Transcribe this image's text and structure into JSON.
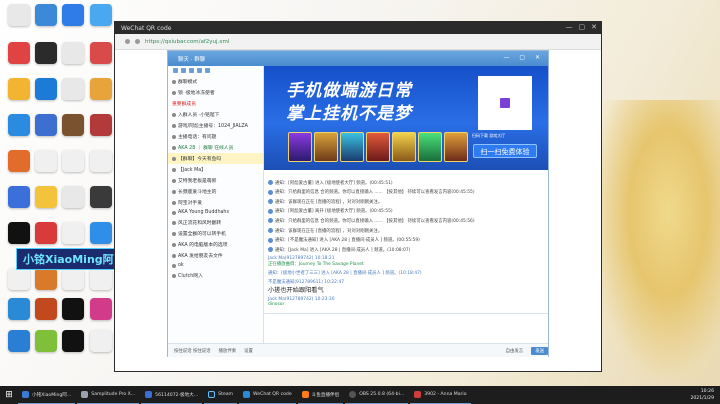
{
  "desktop": {
    "streamer_label": "小铭XiaoMing阿"
  },
  "window": {
    "title": "WeChat QR code",
    "url": "https://qxiubar.com/af2yuj.xml",
    "controls": [
      "—",
      "▢",
      "✕"
    ]
  },
  "qq_group": {
    "top_title": "聊天 · 群聊",
    "left_panel": {
      "rows": [
        {
          "text": "群聊模式",
          "style": "normal"
        },
        {
          "text": "锁 ·极地冰冻使者",
          "style": "normal"
        },
        {
          "text": "重要群成员",
          "style": "red"
        },
        {
          "text": "入群人员 ·小铭陛下",
          "style": "normal"
        },
        {
          "text": "游戏/阿彪主播号：1024_JIALZA",
          "style": "normal"
        },
        {
          "text": "主播电话：有问题",
          "style": "normal"
        },
        {
          "text": "AKA 28 ｜ 群聊 在线人员",
          "style": "green"
        },
        {
          "text": "【群聊】今天有鱼吗",
          "style": "hl"
        },
        {
          "text": "【Jack Ma】",
          "style": "normal"
        },
        {
          "text": "艾特我老板是萌新",
          "style": "normal"
        },
        {
          "text": "长颈鹿爱斗地主的",
          "style": "normal"
        },
        {
          "text": "阿宝对手爱",
          "style": "normal"
        },
        {
          "text": "AKA Young Buddhahs",
          "style": "normal"
        },
        {
          "text": "风正流花和风时翻转",
          "style": "normal"
        },
        {
          "text": "设置全群的可以转手机",
          "style": "normal"
        },
        {
          "text": "AKA 的电脑版本的选项",
          "style": "normal"
        },
        {
          "text": "AKA 发给朋友去文件",
          "style": "normal"
        },
        {
          "text": "ok",
          "style": "normal"
        },
        {
          "text": "Clutch网入",
          "style": "normal"
        }
      ]
    },
    "banner": {
      "line1": "手机做端游日常",
      "line2": "掌上挂机不是梦",
      "qr_caption": "扫码下载 游戏大厅",
      "scan_button": "扫一扫免费体验"
    },
    "messages": [
      {
        "kind": "sys",
        "text": "通知：[阿彪爱古董] 进入 [极地使者大厅]  频道。(00:45:51)"
      },
      {
        "kind": "sys",
        "text": "通知：只给群里的信息 合的频道。你可以直接输入 ......  【按其他】 持续可以查看发言内容(00:45:55)"
      },
      {
        "kind": "sys",
        "text": "通知：该群现在正在 [直播的流程] ，对对对刚刚关注。"
      },
      {
        "kind": "sys",
        "text": "通知：[阿彪爱古董] 离开 [极地使者大厅] 频道。(00:45:55)"
      },
      {
        "kind": "sys",
        "text": "通知：只给群里的信息 合的频道。你可以直接输入 ......  【按其他】 持续可以查看发言内容(00:45:56)"
      },
      {
        "kind": "sys",
        "text": "通知：该群现在正在 [直播的流程] ，对对对刚刚关注。"
      },
      {
        "kind": "sys",
        "text": "通知：[不是魔法通知] 进入 [AKA 28 | 直播间·成员人 ] 频道。(00:55:59)"
      },
      {
        "kind": "sys",
        "text": "通知：[Jack Ma] 进入 [AKA 28 | 直播间·成员人 ] 频道。(10:08:07)"
      },
      {
        "kind": "user",
        "name": "Jack Ma(912789742) 10:18:21",
        "line2": "正在播放曲目：Journey To The Savage Planet",
        "big": ""
      },
      {
        "kind": "user",
        "name": "通知：[极地小世者了三三] 进入 [AKA 28 | 直播间·成员人 ] 频道。(10:18:47)",
        "line2": "",
        "big": ""
      },
      {
        "kind": "user",
        "name": "不是魔法通知(912789611) 10:22:47",
        "line2": "",
        "big": "小搓也开始跟阳看气"
      },
      {
        "kind": "user",
        "name": "Jack Ma(912789742) 10:23:30",
        "line2": "dinosor",
        "big": ""
      }
    ],
    "bottom_bar": {
      "mic": "按住说话 按住说话",
      "record": "播放伴奏",
      "settings": "设置",
      "mode": "自由发言",
      "send": "发送"
    }
  },
  "taskbar": {
    "items": [
      {
        "label": "小铭XiaoMing阿...",
        "color": "#3a7bd5"
      },
      {
        "label": "Samplitude Pro X...",
        "color": "#9aa2ad"
      },
      {
        "label": "56114072·极地大...",
        "color": "#3a6fd8"
      },
      {
        "label": "Steam",
        "color": "#1b2838"
      },
      {
        "label": "WeChat QR code",
        "color": "#2b8ad6"
      },
      {
        "label": "斗鱼直播伴侣",
        "color": "#ff7a1a"
      },
      {
        "label": "OBS 25.0.8 (64-bi...",
        "color": "#555555"
      },
      {
        "label": "3902 - Anna Mario",
        "color": "#d23b3b"
      }
    ],
    "time": "10:26",
    "date": "2021/1/29"
  },
  "colors": {
    "banner_blue": "#1450c9",
    "accent_blue": "#4a8ccf",
    "taskbar": "#1d1d1d"
  }
}
